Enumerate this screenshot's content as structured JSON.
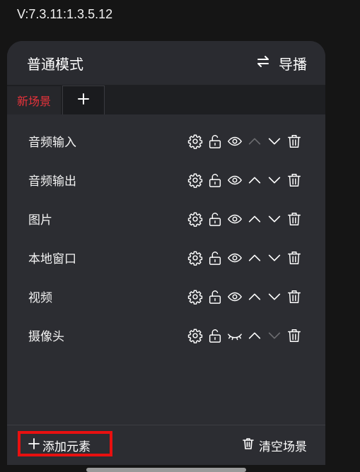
{
  "version": "V:7.3.11:1.3.5.12",
  "header": {
    "title": "普通模式",
    "switch_label": "导播"
  },
  "tabs": {
    "active_label": "新场景",
    "add_label": "+"
  },
  "rows": [
    {
      "label": "音频输入",
      "visible": true,
      "up_enabled": false,
      "down_enabled": true
    },
    {
      "label": "音频输出",
      "visible": true,
      "up_enabled": true,
      "down_enabled": true
    },
    {
      "label": "图片",
      "visible": true,
      "up_enabled": true,
      "down_enabled": true
    },
    {
      "label": "本地窗口",
      "visible": true,
      "up_enabled": true,
      "down_enabled": true
    },
    {
      "label": "视频",
      "visible": true,
      "up_enabled": true,
      "down_enabled": true
    },
    {
      "label": "摄像头",
      "visible": false,
      "up_enabled": true,
      "down_enabled": false
    }
  ],
  "footer": {
    "add_label": "添加元素",
    "clear_label": "清空场景"
  },
  "icons": [
    "gear-icon",
    "unlock-icon",
    "eye-icon",
    "eye-closed-icon",
    "chevron-up-icon",
    "chevron-down-icon",
    "trash-icon",
    "swap-icon",
    "plus-icon"
  ],
  "colors": {
    "accent": "#e8333b",
    "highlight": "#e81010",
    "panel": "#2c2d32"
  }
}
